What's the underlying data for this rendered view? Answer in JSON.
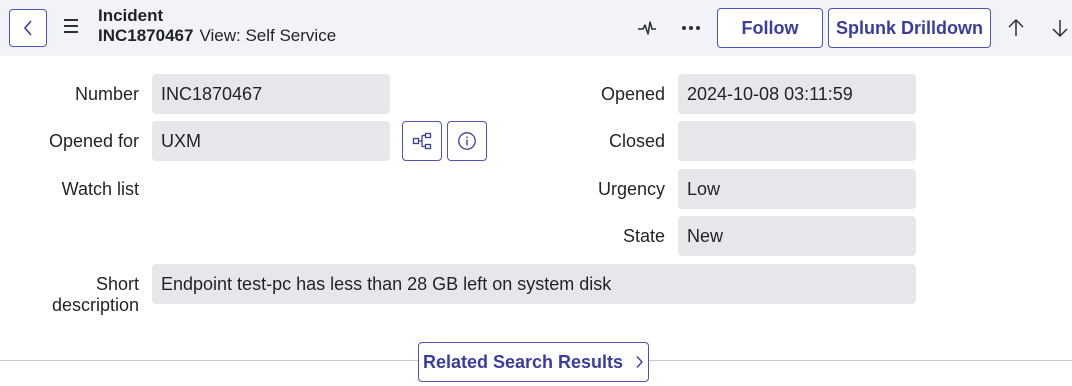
{
  "header": {
    "title": "Incident",
    "number": "INC1870467",
    "view": "View: Self Service",
    "follow_label": "Follow",
    "splunk_label": "Splunk Drilldown"
  },
  "form": {
    "number_label": "Number",
    "number_value": "INC1870467",
    "opened_for_label": "Opened for",
    "opened_for_value": "UXM",
    "watch_list_label": "Watch list",
    "short_description_label_line1": "Short",
    "short_description_label_line2": "description",
    "short_description_value": "Endpoint test-pc has less than 28 GB left on system disk",
    "opened_label": "Opened",
    "opened_value": "2024-10-08 03:11:59",
    "closed_label": "Closed",
    "closed_value": "",
    "urgency_label": "Urgency",
    "urgency_value": "Low",
    "state_label": "State",
    "state_value": "New"
  },
  "related": {
    "label": "Related Search Results"
  },
  "colors": {
    "accent": "#4f52bd",
    "header_bg": "#f2f3f6",
    "field_bg": "#e6e7eb"
  },
  "icons": {
    "back": "chevron-left-icon",
    "menu": "hamburger-menu-icon",
    "activity": "pulse-icon",
    "more": "more-horizontal-icon",
    "up": "arrow-up-icon",
    "down": "arrow-down-icon",
    "hierarchy": "hierarchy-icon",
    "info": "info-icon",
    "chevron": "chevron-right-icon"
  }
}
